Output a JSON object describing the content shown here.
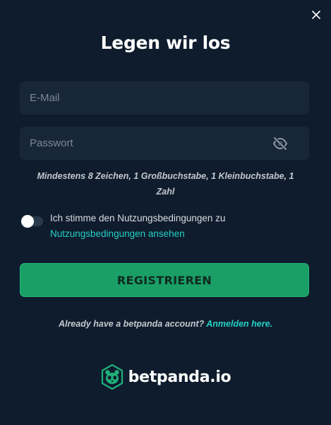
{
  "dialog": {
    "title": "Legen wir los",
    "close_icon": "close-icon"
  },
  "email": {
    "placeholder": "E-Mail",
    "value": ""
  },
  "password": {
    "placeholder": "Passwort",
    "value": "",
    "visibility_icon": "eye-slash-icon"
  },
  "password_hint": "Mindestens 8 Zeichen, 1 Großbuchstabe, 1 Kleinbuchstabe, 1 Zahl",
  "terms": {
    "toggle_on": false,
    "text": "Ich stimme den Nutzungsbedingungen zu",
    "link": "Nutzungsbedingungen ansehen"
  },
  "register_button": "REGISTRIEREN",
  "login": {
    "prompt": "Already have a betpanda account?",
    "link": "Anmelden here."
  },
  "brand": {
    "name": "betpanda.io",
    "logo_icon": "panda-logo-icon"
  },
  "colors": {
    "background": "#0f1c2d",
    "field": "#172738",
    "accent_green": "#1a9f66",
    "link_teal": "#25d0c6"
  }
}
